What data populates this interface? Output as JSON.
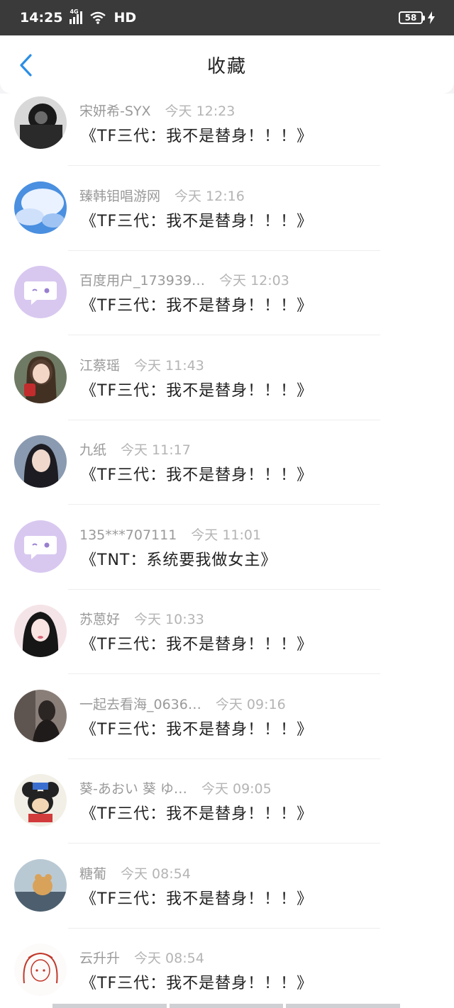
{
  "status_bar": {
    "time": "14:25",
    "network": "4G",
    "hd": "HD",
    "battery": "58"
  },
  "header": {
    "title": "收藏"
  },
  "colors": {
    "accent": "#2a8ee6"
  },
  "items": [
    {
      "name": "宋妍希-SYX",
      "time": "今天 12:23",
      "content": "《TF三代：我不是替身！！！》",
      "avatar": "photo-dark"
    },
    {
      "name": "臻韩钼唱游网",
      "time": "今天 12:16",
      "content": "《TF三代：我不是替身！！！》",
      "avatar": "photo-sky"
    },
    {
      "name": "百度用户_173939…",
      "time": "今天 12:03",
      "content": "《TF三代：我不是替身！！！》",
      "avatar": "default-chat"
    },
    {
      "name": "江蔡瑶",
      "time": "今天 11:43",
      "content": "《TF三代：我不是替身！！！》",
      "avatar": "photo-girl-red"
    },
    {
      "name": "九纸",
      "time": "今天 11:17",
      "content": "《TF三代：我不是替身！！！》",
      "avatar": "photo-girl"
    },
    {
      "name": "135***707111",
      "time": "今天 11:01",
      "content": "《TNT：系统要我做女主》",
      "avatar": "default-chat"
    },
    {
      "name": "苏蒽好",
      "time": "今天 10:33",
      "content": "《TF三代：我不是替身！！！》",
      "avatar": "photo-girl-pink"
    },
    {
      "name": "一起去看海_0636…",
      "time": "今天 09:16",
      "content": "《TF三代：我不是替身！！！》",
      "avatar": "photo-boy"
    },
    {
      "name": "葵-あおい 葵 ゆ…",
      "time": "今天 09:05",
      "content": "《TF三代：我不是替身！！！》",
      "avatar": "photo-cartoon"
    },
    {
      "name": "糖葡",
      "time": "今天 08:54",
      "content": "《TF三代：我不是替身！！！》",
      "avatar": "photo-dog"
    },
    {
      "name": "云升升",
      "time": "今天 08:54",
      "content": "《TF三代：我不是替身！！！》",
      "avatar": "photo-drawing"
    }
  ]
}
